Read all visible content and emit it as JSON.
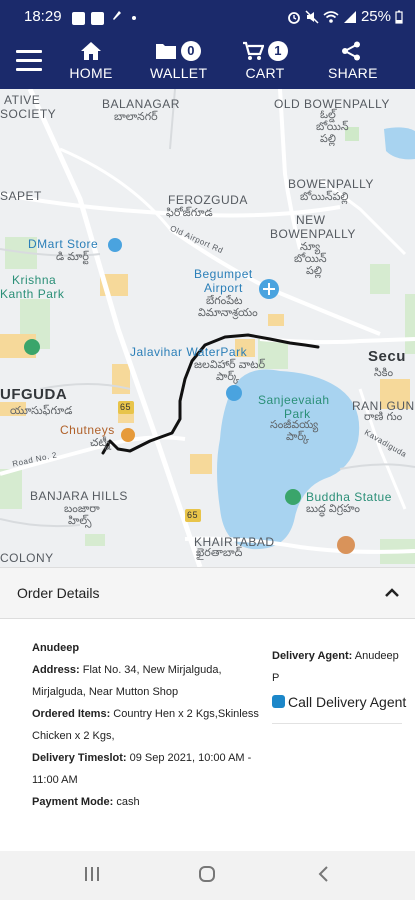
{
  "status_bar": {
    "time": "18:29",
    "battery": "25%",
    "icons": [
      "gallery-icon",
      "image-icon",
      "pin-icon",
      "alarm-icon",
      "mute-icon",
      "wifi-icon",
      "signal-icon",
      "battery-icon"
    ]
  },
  "nav": {
    "menu_icon": "hamburger-icon",
    "items": [
      {
        "label": "HOME",
        "icon": "home-icon"
      },
      {
        "label": "WALLET",
        "icon": "folder-icon",
        "badge": "0"
      },
      {
        "label": "CART",
        "icon": "cart-icon",
        "badge": "1"
      },
      {
        "label": "SHARE",
        "icon": "share-icon"
      }
    ]
  },
  "map": {
    "labels": [
      {
        "text": "ATIVE"
      },
      {
        "text": "SOCIETY"
      },
      {
        "text": "BALANAGAR"
      },
      {
        "text": "బాలానగర్"
      },
      {
        "text": "OLD BOWENPALLY"
      },
      {
        "text": "ఓల్డ్"
      },
      {
        "text": "బోయిన్"
      },
      {
        "text": "పల్లి"
      },
      {
        "text": "FEROZGUDA"
      },
      {
        "text": "ఫిరోజ్‌గూడ"
      },
      {
        "text": "BOWENPALLY"
      },
      {
        "text": "బోయిన్‌పల్లి"
      },
      {
        "text": "NEW"
      },
      {
        "text": "BOWENPALLY"
      },
      {
        "text": "న్యూ"
      },
      {
        "text": "బోయిన్"
      },
      {
        "text": "పల్లి"
      },
      {
        "text": "SAPET"
      },
      {
        "text": "DMart Store"
      },
      {
        "text": "డి మార్ట్"
      },
      {
        "text": "Krishna"
      },
      {
        "text": "Kanth Park"
      },
      {
        "text": "Begumpet"
      },
      {
        "text": "Airport"
      },
      {
        "text": "బేగంపేట"
      },
      {
        "text": "విమానాశ్రయం"
      },
      {
        "text": "Jalavihar WaterPark"
      },
      {
        "text": "జలవిహార్ వాటర్"
      },
      {
        "text": "పార్క్"
      },
      {
        "text": "Secu"
      },
      {
        "text": "సికిం"
      },
      {
        "text": "UFGUDA"
      },
      {
        "text": "యూసుఫ్‌గూడ"
      },
      {
        "text": "Sanjeevaiah"
      },
      {
        "text": "Park"
      },
      {
        "text": "సంజీవయ్య"
      },
      {
        "text": "పార్క్"
      },
      {
        "text": "RANI GUN"
      },
      {
        "text": "రాణి గుం"
      },
      {
        "text": "Chutneys"
      },
      {
        "text": "చట్నీ"
      },
      {
        "text": "BANJARA HILLS"
      },
      {
        "text": "బంజారా"
      },
      {
        "text": "హిల్స్"
      },
      {
        "text": "Buddha Statue"
      },
      {
        "text": "బుద్ధ విగ్రహం"
      },
      {
        "text": "KHAIRTABAD"
      },
      {
        "text": "ఖైరతాబాద్"
      },
      {
        "text": "COLONY"
      },
      {
        "text": "65"
      },
      {
        "text": "65"
      },
      {
        "text": "Old Airport Rd"
      },
      {
        "text": "Road No. 2"
      },
      {
        "text": "Kavadiguda"
      }
    ],
    "route_color": "#111111",
    "water_color": "#a8d3f0",
    "park_color": "#cfe9c9"
  },
  "order_details": {
    "title": "Order Details",
    "toggle_icon": "chevron-up-icon",
    "customer_name": "Anudeep",
    "address_label": "Address:",
    "address_value": " Flat No. 34, New Mirjalguda, Mirjalguda, Near Mutton Shop",
    "items_label": "Ordered Items:",
    "items_value": " Country Hen x 2 Kgs,Skinless Chicken x 2 Kgs,",
    "timeslot_label": "Delivery Timeslot:",
    "timeslot_value": " 09 Sep 2021, 10:00 AM - 11:00 AM",
    "payment_label": "Payment Mode:",
    "payment_value": " cash",
    "agent_label": "Delivery Agent:",
    "agent_value": " Anudeep P",
    "call_label": "Call Delivery Agent"
  },
  "system_nav": {
    "buttons": [
      "recent-apps-icon",
      "home-circle-icon",
      "back-icon"
    ]
  }
}
